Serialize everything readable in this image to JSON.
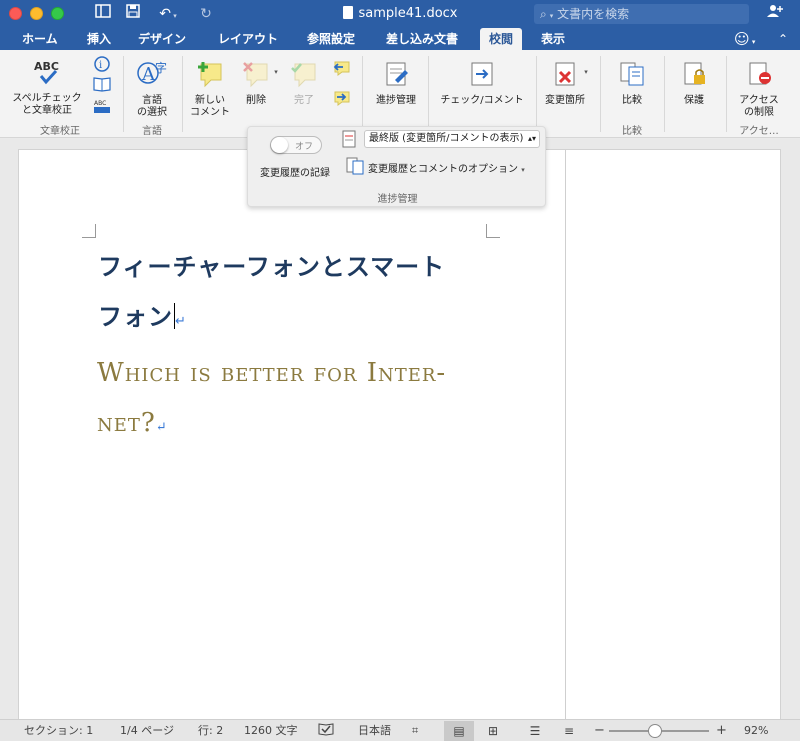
{
  "window": {
    "title": "sample41.docx",
    "search_placeholder": "文書内を検索"
  },
  "tabs": [
    {
      "label": "ホーム"
    },
    {
      "label": "挿入"
    },
    {
      "label": "デザイン"
    },
    {
      "label": "レイアウト"
    },
    {
      "label": "参照設定"
    },
    {
      "label": "差し込み文書"
    },
    {
      "label": "校閲",
      "active": true
    },
    {
      "label": "表示"
    }
  ],
  "ribbon": {
    "spellcheck": "スペルチェック\nと文章校正",
    "group_proofing": "文章校正",
    "language": "言語\nの選択",
    "group_language": "言語",
    "new_comment": "新しい\nコメント",
    "delete": "削除",
    "done": "完了",
    "track_changes": "進捗管理",
    "check_comment": "チェック/コメント",
    "changes": "変更箇所",
    "compare": "比較",
    "group_compare": "比較",
    "protect": "保護",
    "restrict": "アクセス\nの制限",
    "group_access": "アクセ…"
  },
  "popup": {
    "toggle_label": "オフ",
    "record_label": "変更履歴の記録",
    "display_select": "最終版 (変更箇所/コメントの表示)",
    "options_label": "変更履歴とコメントのオプション",
    "group_label": "進捗管理"
  },
  "document": {
    "heading_line1": "フィーチャーフォンとスマート",
    "heading_line2": "フォン",
    "subtitle_line1": "Which is better for Inter-",
    "subtitle_line2": "net?"
  },
  "status": {
    "section": "セクション: 1",
    "page": "1/4 ページ",
    "line": "行: 2",
    "words": "1260 文字",
    "language": "日本語",
    "zoom": "92%",
    "zoom_level": 0.5
  },
  "colors": {
    "title_bar": "#2c5ea5",
    "heading": "#1e3a5f",
    "subtitle": "#8b7a3f"
  }
}
